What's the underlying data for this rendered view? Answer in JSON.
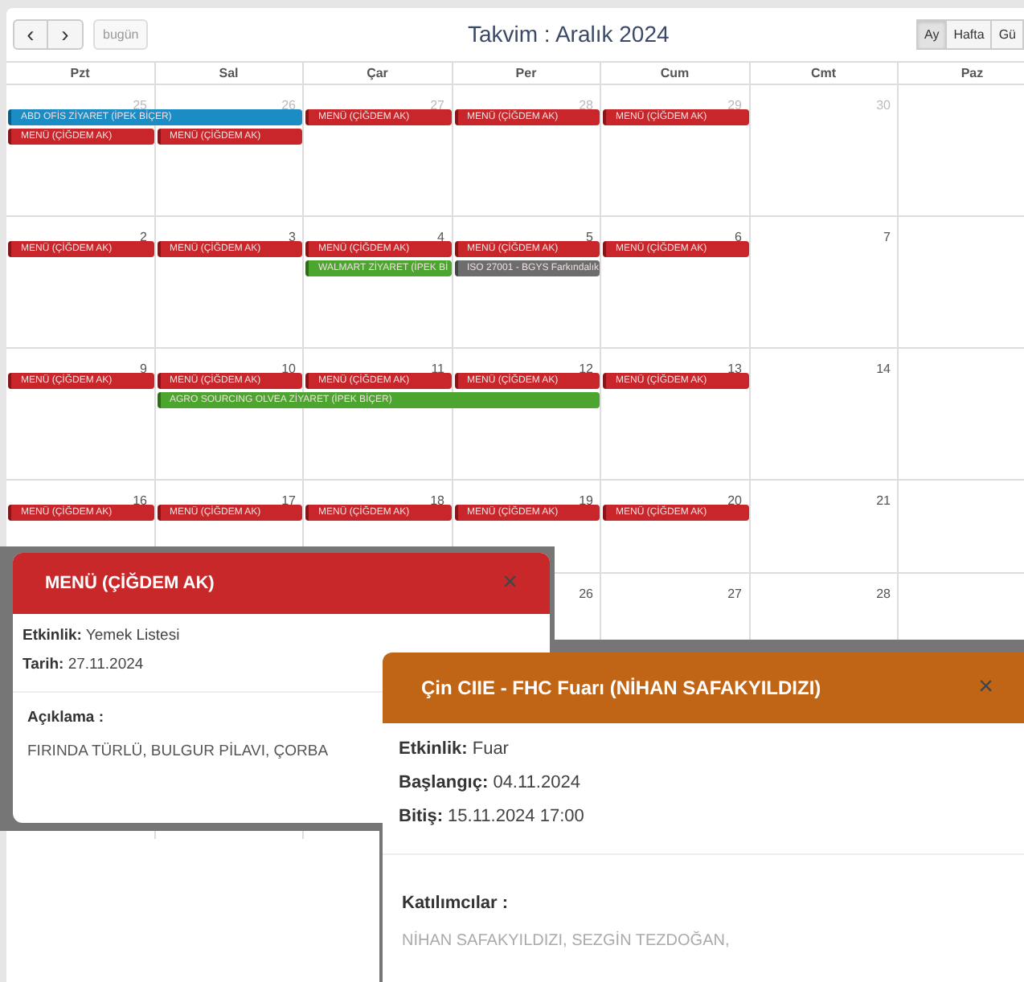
{
  "toolbar": {
    "prev": "‹",
    "next": "›",
    "today": {
      "label": "bugün",
      "disabled": true
    },
    "title": "Takvim : Aralık 2024",
    "views": [
      {
        "label": "Ay",
        "selected": true
      },
      {
        "label": "Hafta",
        "selected": false
      },
      {
        "label": "Gü",
        "selected": false
      }
    ]
  },
  "weekdays": [
    "Pzt",
    "Sal",
    "Çar",
    "Per",
    "Cum",
    "Cmt",
    "Paz"
  ],
  "weeks": [
    {
      "days": [
        {
          "kind": "date",
          "number": "25",
          "other_month": true
        },
        {
          "kind": "date",
          "number": "26",
          "other_month": true
        },
        {
          "kind": "date",
          "number": "27",
          "other_month": true
        },
        {
          "kind": "date",
          "number": "28",
          "other_month": true
        },
        {
          "kind": "date",
          "number": "29",
          "other_month": true
        },
        {
          "kind": "date",
          "number": "30",
          "other_month": true
        },
        {
          "kind": "blank"
        }
      ],
      "lanes": [
        [
          {
            "kind": "event",
            "title": "ABD OFİS ZİYARET (İPEK BİÇER)",
            "color": "#1b8dc4"
          },
          {
            "kind": "continued"
          },
          {
            "kind": "event",
            "title": "MENÜ (ÇİĞDEM AK)",
            "color": "#c9262c"
          },
          {
            "kind": "event",
            "title": "MENÜ (ÇİĞDEM AK)",
            "color": "#c9262c"
          },
          {
            "kind": "event",
            "title": "MENÜ (ÇİĞDEM AK)",
            "color": "#c9262c"
          }
        ],
        [
          {
            "kind": "event",
            "title": "MENÜ (ÇİĞDEM AK)",
            "color": "#c9262c"
          },
          {
            "kind": "event",
            "title": "MENÜ (ÇİĞDEM AK)",
            "color": "#c9262c"
          }
        ]
      ]
    },
    {
      "days": [
        {
          "kind": "date",
          "number": "2",
          "other_month": false
        },
        {
          "kind": "date",
          "number": "3",
          "other_month": false
        },
        {
          "kind": "date",
          "number": "4",
          "other_month": false
        },
        {
          "kind": "date",
          "number": "5",
          "other_month": false
        },
        {
          "kind": "date",
          "number": "6",
          "other_month": false
        },
        {
          "kind": "date",
          "number": "7",
          "other_month": false
        },
        {
          "kind": "blank"
        }
      ],
      "lanes": [
        [
          {
            "kind": "event",
            "title": "MENÜ (ÇİĞDEM AK)",
            "color": "#c9262c"
          },
          {
            "kind": "event",
            "title": "MENÜ (ÇİĞDEM AK)",
            "color": "#c9262c"
          },
          {
            "kind": "event",
            "title": "MENÜ (ÇİĞDEM AK)",
            "color": "#c9262c"
          },
          {
            "kind": "event",
            "title": "MENÜ (ÇİĞDEM AK)",
            "color": "#c9262c"
          },
          {
            "kind": "event",
            "title": "MENÜ (ÇİĞDEM AK)",
            "color": "#c9262c"
          }
        ],
        [
          {
            "kind": "empty"
          },
          {
            "kind": "empty"
          },
          {
            "kind": "event",
            "title": "WALMART ZİYARET (İPEK Bİ",
            "color": "#4ba52f"
          },
          {
            "kind": "event",
            "title": "ISO 27001 - BGYS Farkındalık",
            "color": "#6d6d6d"
          }
        ]
      ]
    },
    {
      "days": [
        {
          "kind": "date",
          "number": "9",
          "other_month": false
        },
        {
          "kind": "date",
          "number": "10",
          "other_month": false
        },
        {
          "kind": "date",
          "number": "11",
          "other_month": false
        },
        {
          "kind": "date",
          "number": "12",
          "other_month": false
        },
        {
          "kind": "date",
          "number": "13",
          "other_month": false
        },
        {
          "kind": "date",
          "number": "14",
          "other_month": false
        },
        {
          "kind": "blank"
        }
      ],
      "lanes": [
        [
          {
            "kind": "event",
            "title": "MENÜ (ÇİĞDEM AK)",
            "color": "#c9262c"
          },
          {
            "kind": "event",
            "title": "MENÜ (ÇİĞDEM AK)",
            "color": "#c9262c"
          },
          {
            "kind": "event",
            "title": "MENÜ (ÇİĞDEM AK)",
            "color": "#c9262c"
          },
          {
            "kind": "event",
            "title": "MENÜ (ÇİĞDEM AK)",
            "color": "#c9262c"
          },
          {
            "kind": "event",
            "title": "MENÜ (ÇİĞDEM AK)",
            "color": "#c9262c"
          }
        ],
        [
          {
            "kind": "empty"
          },
          {
            "kind": "event",
            "title": "AGRO SOURCING OLVEA ZİYARET (İPEK BİÇER)",
            "color": "#4ba52f"
          },
          {
            "kind": "continued"
          },
          {
            "kind": "continued"
          }
        ]
      ]
    },
    {
      "days": [
        {
          "kind": "date",
          "number": "16",
          "other_month": false
        },
        {
          "kind": "date",
          "number": "17",
          "other_month": false
        },
        {
          "kind": "date",
          "number": "18",
          "other_month": false
        },
        {
          "kind": "date",
          "number": "19",
          "other_month": false
        },
        {
          "kind": "date",
          "number": "20",
          "other_month": false
        },
        {
          "kind": "date",
          "number": "21",
          "other_month": false
        },
        {
          "kind": "blank"
        }
      ],
      "lanes": [
        [
          {
            "kind": "event",
            "title": "MENÜ (ÇİĞDEM AK)",
            "color": "#c9262c"
          },
          {
            "kind": "event",
            "title": "MENÜ (ÇİĞDEM AK)",
            "color": "#c9262c"
          },
          {
            "kind": "event",
            "title": "MENÜ (ÇİĞDEM AK)",
            "color": "#c9262c"
          },
          {
            "kind": "event",
            "title": "MENÜ (ÇİĞDEM AK)",
            "color": "#c9262c"
          },
          {
            "kind": "event",
            "title": "MENÜ (ÇİĞDEM AK)",
            "color": "#c9262c"
          }
        ]
      ]
    },
    {
      "days": [
        {
          "kind": "blank"
        },
        {
          "kind": "blank"
        },
        {
          "kind": "blank"
        },
        {
          "kind": "date",
          "number": "26",
          "other_month": false
        },
        {
          "kind": "date",
          "number": "27",
          "other_month": false
        },
        {
          "kind": "date",
          "number": "28",
          "other_month": false
        },
        {
          "kind": "blank"
        }
      ]
    }
  ],
  "popups": [
    {
      "title": "MENÜ (ÇİĞDEM AK)",
      "color": "#c9282b",
      "close": "×",
      "fields": [
        {
          "label": "Etkinlik:",
          "value": "Yemek Listesi"
        },
        {
          "label": "Tarih:",
          "value": "27.11.2024"
        }
      ],
      "section": {
        "heading": "Açıklama :",
        "text": "FIRINDA TÜRLÜ, BULGUR PİLAVI, ÇORBA"
      }
    },
    {
      "title": "Çin CIIE - FHC Fuarı (NİHAN SAFAKYILDIZI)",
      "color": "#c06416",
      "close": "×",
      "fields": [
        {
          "label": "Etkinlik:",
          "value": "Fuar"
        },
        {
          "label": "Başlangıç:",
          "value": "04.11.2024"
        },
        {
          "label": "Bitiş:",
          "value": "15.11.2024 17:00"
        }
      ],
      "section": {
        "heading": "Katılımcılar :",
        "text": "NİHAN SAFAKYILDIZI, SEZGİN TEZDOĞAN,"
      }
    }
  ]
}
